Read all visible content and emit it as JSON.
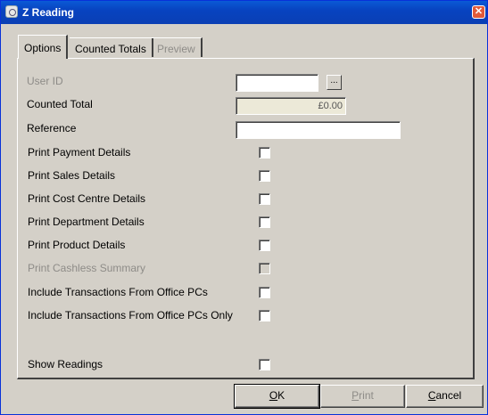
{
  "window": {
    "title": "Z Reading",
    "close_glyph": "✕",
    "icon": "app-icon"
  },
  "tabs": [
    {
      "label": "Options",
      "state": "active"
    },
    {
      "label": "Counted Totals",
      "state": "inactive"
    },
    {
      "label": "Preview",
      "state": "disabled"
    }
  ],
  "fields": {
    "user_id": {
      "label": "User ID",
      "value": "",
      "browse": "..."
    },
    "counted_total": {
      "label": "Counted Total",
      "value": "£0.00"
    },
    "reference": {
      "label": "Reference",
      "value": ""
    }
  },
  "options": [
    {
      "label": "Print Payment Details",
      "checked": false,
      "enabled": true
    },
    {
      "label": "Print Sales Details",
      "checked": false,
      "enabled": true
    },
    {
      "label": "Print Cost Centre Details",
      "checked": false,
      "enabled": true
    },
    {
      "label": "Print Department Details",
      "checked": false,
      "enabled": true
    },
    {
      "label": "Print Product Details",
      "checked": false,
      "enabled": true
    },
    {
      "label": "Print Cashless Summary",
      "checked": false,
      "enabled": false
    },
    {
      "label": "Include Transactions From Office PCs",
      "checked": false,
      "enabled": true
    },
    {
      "label": "Include Transactions From Office PCs Only",
      "checked": false,
      "enabled": true
    },
    {
      "label": "Show Readings",
      "checked": false,
      "enabled": true
    }
  ],
  "buttons": {
    "ok": {
      "mnemonic": "O",
      "rest": "K"
    },
    "print": {
      "mnemonic": "P",
      "rest": "rint"
    },
    "cancel": {
      "mnemonic": "C",
      "rest": "ancel"
    }
  }
}
